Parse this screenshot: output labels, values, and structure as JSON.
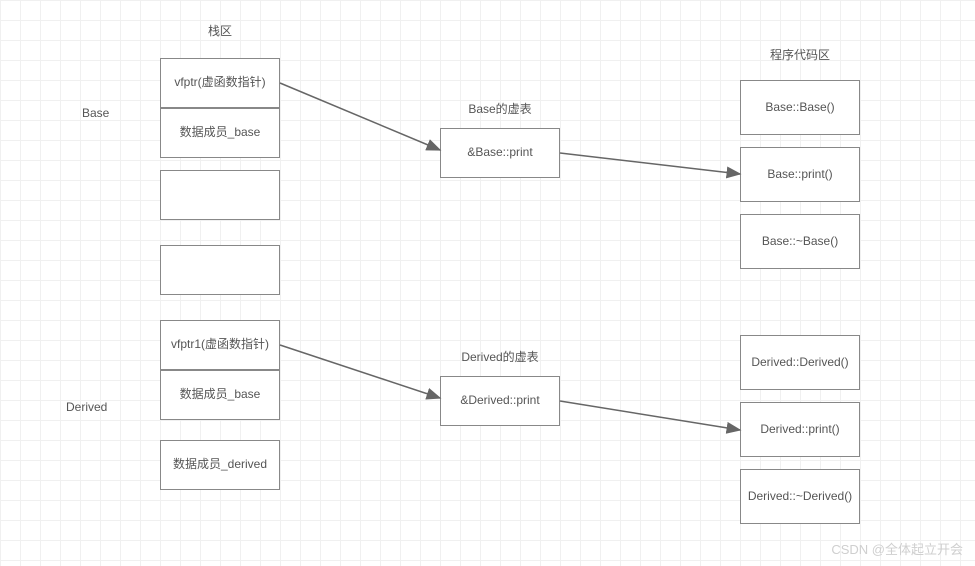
{
  "headings": {
    "stack": "栈区",
    "base_vtable": "Base的虚表",
    "derived_vtable": "Derived的虚表",
    "code_area": "程序代码区"
  },
  "side_labels": {
    "base": "Base",
    "derived": "Derived"
  },
  "stack": {
    "base_vfptr": "vfptr(虚函数指针)",
    "base_member": "数据成员_base",
    "derived_vfptr": "vfptr1(虚函数指针)",
    "derived_member_base": "数据成员_base",
    "derived_member_derived": "数据成员_derived"
  },
  "vtables": {
    "base_print": "&Base::print",
    "derived_print": "&Derived::print"
  },
  "code": {
    "base_ctor": "Base::Base()",
    "base_print": "Base::print()",
    "base_dtor": "Base::~Base()",
    "derived_ctor": "Derived::Derived()",
    "derived_print": "Derived::print()",
    "derived_dtor": "Derived::~Derived()"
  },
  "watermark": "CSDN @全体起立开会"
}
